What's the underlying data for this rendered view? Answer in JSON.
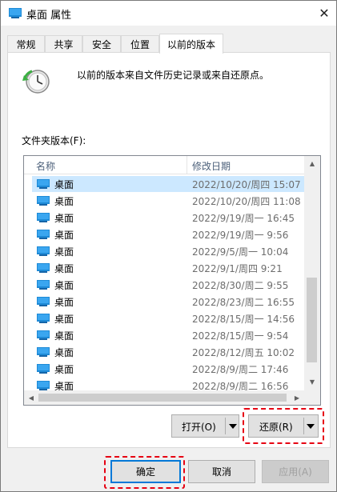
{
  "window": {
    "title": "桌面 属性",
    "close_glyph": "✕"
  },
  "tabs": [
    {
      "label": "常规"
    },
    {
      "label": "共享"
    },
    {
      "label": "安全"
    },
    {
      "label": "位置"
    },
    {
      "label": "以前的版本",
      "active": true
    }
  ],
  "panel": {
    "description": "以前的版本来自文件历史记录或来自还原点。",
    "list_label": "文件夹版本(F):",
    "columns": {
      "name": "名称",
      "date": "修改日期"
    },
    "rows": [
      {
        "name": "桌面",
        "date": "2022/10/20/周四 15:07",
        "selected": true
      },
      {
        "name": "桌面",
        "date": "2022/10/20/周四 11:08"
      },
      {
        "name": "桌面",
        "date": "2022/9/19/周一 16:45"
      },
      {
        "name": "桌面",
        "date": "2022/9/19/周一 9:56"
      },
      {
        "name": "桌面",
        "date": "2022/9/5/周一 10:04"
      },
      {
        "name": "桌面",
        "date": "2022/9/1/周四 9:21"
      },
      {
        "name": "桌面",
        "date": "2022/8/30/周二 9:55"
      },
      {
        "name": "桌面",
        "date": "2022/8/23/周二 16:55"
      },
      {
        "name": "桌面",
        "date": "2022/8/15/周一 14:56"
      },
      {
        "name": "桌面",
        "date": "2022/8/15/周一 9:54"
      },
      {
        "name": "桌面",
        "date": "2022/8/12/周五 10:02"
      },
      {
        "name": "桌面",
        "date": "2022/8/9/周二 17:46"
      },
      {
        "name": "桌面",
        "date": "2022/8/9/周二 16:56"
      }
    ],
    "open_button": "打开(O)",
    "restore_button": "还原(R)"
  },
  "footer": {
    "ok": "确定",
    "cancel": "取消",
    "apply": "应用(A)"
  },
  "colors": {
    "selection": "#cce8ff",
    "folder_blue": "#1e8ad6",
    "callout_red": "#e60012",
    "accent": "#0078d7"
  }
}
